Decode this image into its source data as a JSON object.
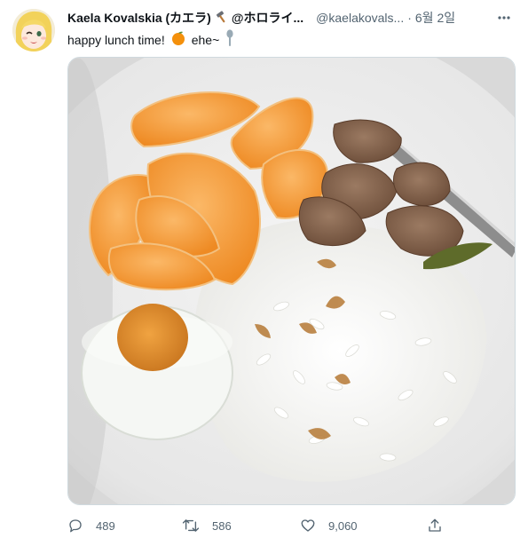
{
  "tweet": {
    "author": {
      "display_name": "Kaela Kovalskia (カエラ)",
      "badge_icon": "hammer-icon",
      "handle_prefix": "@ホロライ...",
      "handle": "@kaelakovals...",
      "separator": "·",
      "date": "6월 2일"
    },
    "text": {
      "before_emoji": "happy lunch time!",
      "emoji_1": "tangerine-icon",
      "after_emoji": "ehe~",
      "emoji_2": "spoon-icon"
    },
    "media": {
      "type": "photo",
      "subject": "bowl of rice, tangerine slices, salted egg and braised meat"
    },
    "stats": {
      "replies": "489",
      "retweets": "586",
      "likes": "9,060"
    }
  },
  "colors": {
    "text_primary": "#0f1419",
    "text_secondary": "#536471",
    "border": "#cfd9de"
  }
}
